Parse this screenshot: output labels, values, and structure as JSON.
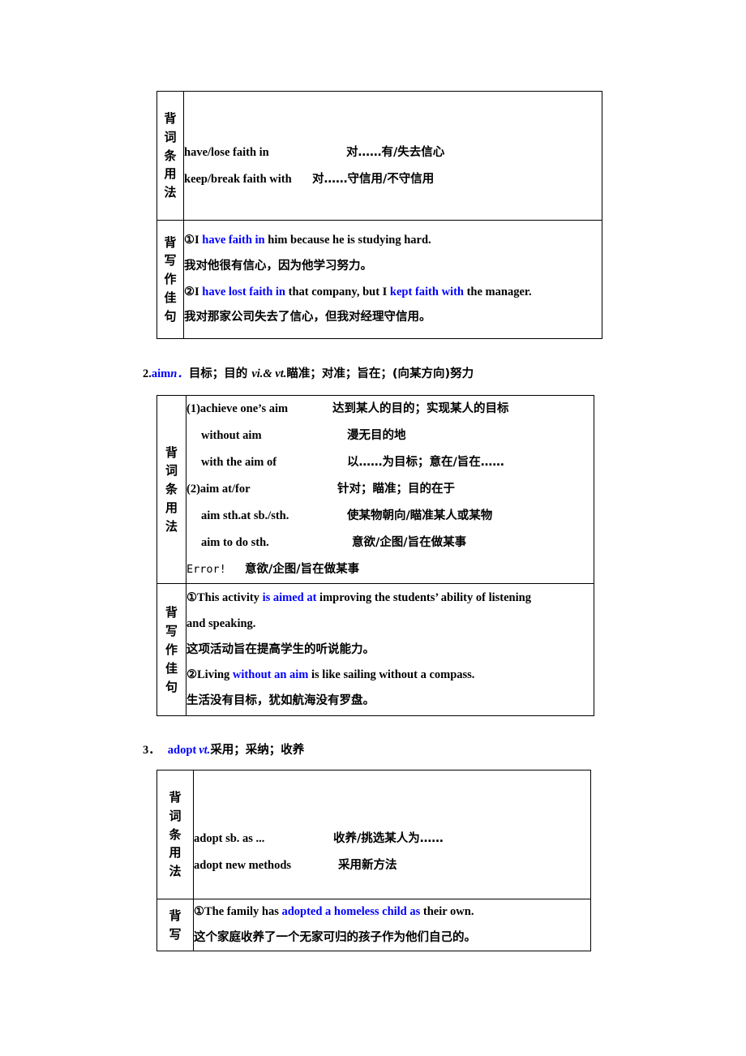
{
  "colors": {
    "highlight": "#0000FF",
    "text": "#000000",
    "border": "#000000",
    "background": "#FFFFFF"
  },
  "labels": {
    "beici_tiaoyong_fa": "背词条用法",
    "beixie_zuojia_ju": "背写作佳句",
    "beixie": "背写"
  },
  "entries": [
    {
      "heading": null,
      "usage_rows": [
        {
          "en": "have/lose faith in",
          "zh": "对……有/失去信心"
        },
        {
          "en": "keep/break faith with",
          "zh": "对……守信用/不守信用"
        }
      ],
      "sentences": [
        {
          "marker": "①",
          "pre": "I ",
          "hl": "have faith in",
          "post": " him because he is studying hard."
        },
        {
          "zh": "我对他很有信心，因为他学习努力。"
        },
        {
          "marker": "②",
          "pre": "I ",
          "hl": "have lost faith in",
          "mid": " that company, but I ",
          "hl2": "kept faith with",
          "post": " the manager."
        },
        {
          "zh": "我对那家公司失去了信心，但我对经理守信用。"
        }
      ]
    },
    {
      "heading": {
        "num": "2.",
        "word": "aim",
        "pos": "n．",
        "zh1": "目标；目的",
        "pos2": "vi.& vt.",
        "zh2": "瞄准；对准；旨在；(向某方向)努力"
      },
      "usage_rows": [
        {
          "en": "(1)achieve one’s aim",
          "zh": "达到某人的目的；实现某人的目标"
        },
        {
          "en": "without aim",
          "zh": "漫无目的地",
          "indent": true
        },
        {
          "en": "with the aim of",
          "zh": "以……为目标；意在/旨在……",
          "indent": true
        },
        {
          "en": "(2)aim at/for",
          "zh": "针对；瞄准；目的在于"
        },
        {
          "en": "aim sth.at sb./sth.",
          "zh": "使某物朝向/瞄准某人或某物",
          "indent": true
        },
        {
          "en": "aim to do sth.",
          "zh": "意欲/企图/旨在做某事",
          "indent": true
        },
        {
          "en": "Error!",
          "zh": "意欲/企图/旨在做某事",
          "mono": true
        }
      ],
      "sentences": [
        {
          "marker": "①",
          "pre": "This activity ",
          "hl": "is aimed at",
          "post": " improving the students’ ability of listening"
        },
        {
          "cont": "and speaking."
        },
        {
          "zh": "这项活动旨在提高学生的听说能力。"
        },
        {
          "marker": "②",
          "pre": "Living ",
          "hl": "without an aim",
          "post": " is like sailing without a compass."
        },
        {
          "zh": "生活没有目标，犹如航海没有罗盘。"
        }
      ]
    },
    {
      "heading": {
        "num": "3．",
        "word": "adopt",
        "pos": "vt.",
        "zh1": "采用；采纳；收养",
        "pos2": "",
        "zh2": ""
      },
      "usage_rows": [
        {
          "en": "adopt sb. as ...",
          "zh": "收养/挑选某人为……"
        },
        {
          "en": "adopt new methods",
          "zh": "采用新方法"
        }
      ],
      "sentences": [
        {
          "marker": "①",
          "pre": "The family has ",
          "hl": "adopted a homeless child as",
          "post": " their own."
        },
        {
          "zh": "这个家庭收养了一个无家可归的孩子作为他们自己的。"
        }
      ]
    }
  ]
}
